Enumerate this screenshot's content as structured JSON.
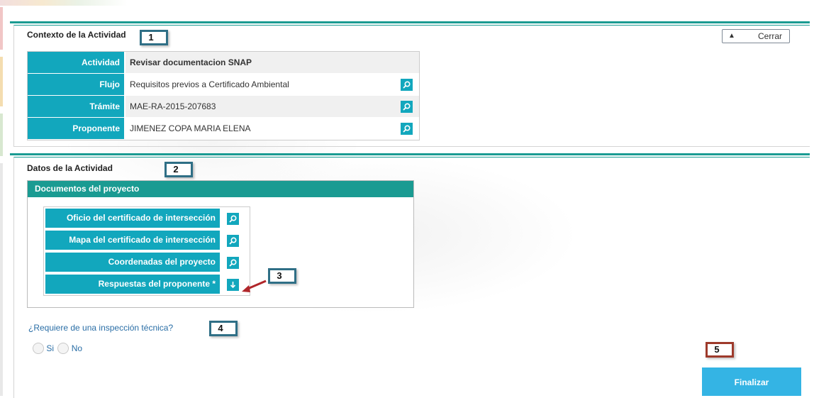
{
  "activity_context": {
    "title": "Contexto de la Actividad",
    "close_label": "Cerrar",
    "rows": [
      {
        "label": "Actividad",
        "value": "Revisar documentacion SNAP"
      },
      {
        "label": "Flujo",
        "value": "Requisitos previos a Certificado Ambiental"
      },
      {
        "label": "Trámite",
        "value": "MAE-RA-2015-207683"
      },
      {
        "label": "Proponente",
        "value": "JIMENEZ COPA MARIA ELENA"
      }
    ]
  },
  "activity_data": {
    "title": "Datos de la Actividad",
    "documents_header": "Documentos del proyecto",
    "documents": [
      {
        "label": "Oficio del certificado de intersección",
        "icon": "search-icon"
      },
      {
        "label": "Mapa del certificado de intersección",
        "icon": "search-icon"
      },
      {
        "label": "Coordenadas del proyecto",
        "icon": "search-icon"
      },
      {
        "label": "Respuestas del proponente *",
        "icon": "download-icon"
      }
    ],
    "inspection_question": "¿Requiere de una inspección técnica?",
    "options": [
      "Si",
      "No"
    ]
  },
  "actions": {
    "finalize_label": "Finalizar"
  },
  "callouts": [
    "1",
    "2",
    "3",
    "4",
    "5"
  ],
  "colors": {
    "teal": "#1a9b92",
    "cyan": "#12a7bd",
    "finalize": "#34b4e4",
    "callout_border": "#2f6f86",
    "callout_red": "#9e3a2b"
  }
}
